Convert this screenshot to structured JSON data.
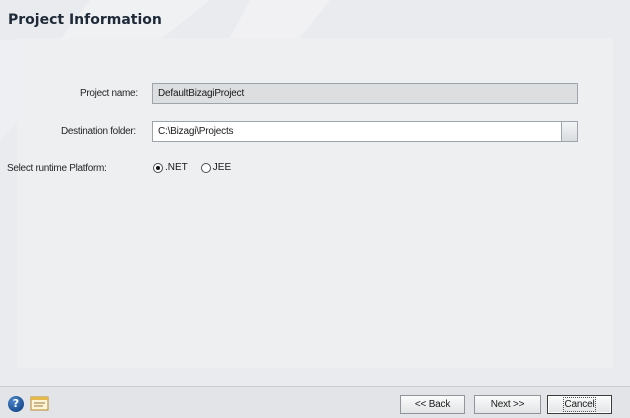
{
  "page": {
    "title": "Project Information"
  },
  "form": {
    "project_name_label": "Project name:",
    "project_name_value": "DefaultBizagiProject",
    "destination_label": "Destination folder:",
    "destination_value": "C:\\Bizagi\\Projects",
    "runtime_label": "Select runtime Platform:",
    "runtime_options": [
      {
        "label": ".NET",
        "selected": true
      },
      {
        "label": "JEE",
        "selected": false
      }
    ]
  },
  "footer": {
    "help_icon": "help-icon",
    "doc_icon": "document-icon",
    "back_label": "<< Back",
    "next_label": "Next >>",
    "cancel_label": "Cancel"
  }
}
